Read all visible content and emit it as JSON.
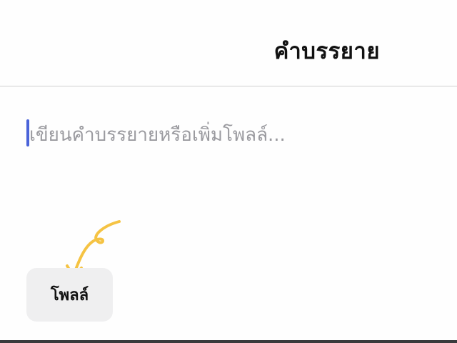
{
  "header": {
    "title": "คำบรรยาย"
  },
  "caption": {
    "placeholder": "เขียนคำบรรยายหรือเพิ่มโพลล์..."
  },
  "poll_button": {
    "label": "โพลล์"
  },
  "colors": {
    "caret": "#4a63d9",
    "arrow": "#f5c343",
    "button_bg": "#efeff0",
    "placeholder_text": "#9a9a9f",
    "title_text": "#111111"
  },
  "icons": {
    "annotation_arrow": "curved-arrow-icon"
  }
}
